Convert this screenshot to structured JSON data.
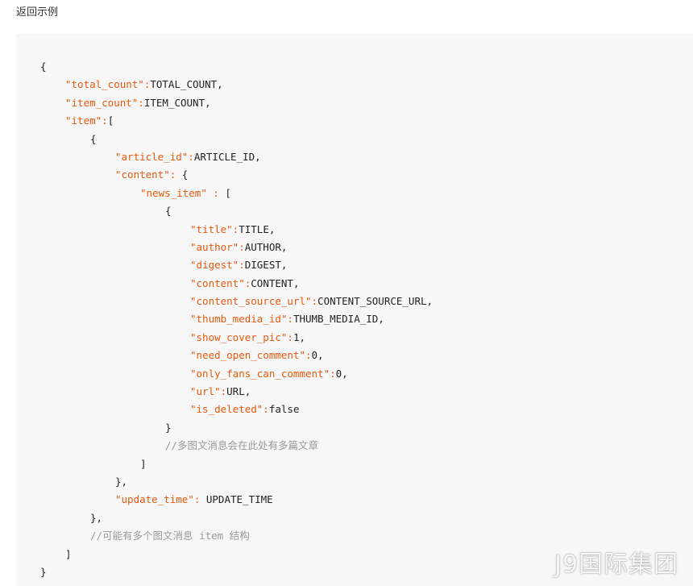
{
  "section_title": "返回示例",
  "watermark": "J9国际集团",
  "code_lines": [
    {
      "indent": 0,
      "segments": [
        {
          "t": "p",
          "v": "{"
        }
      ]
    },
    {
      "indent": 1,
      "segments": [
        {
          "t": "k",
          "v": "\"total_count\":"
        },
        {
          "t": "p",
          "v": "TOTAL_COUNT,"
        }
      ]
    },
    {
      "indent": 1,
      "segments": [
        {
          "t": "k",
          "v": "\"item_count\":"
        },
        {
          "t": "p",
          "v": "ITEM_COUNT,"
        }
      ]
    },
    {
      "indent": 1,
      "segments": [
        {
          "t": "k",
          "v": "\"item\":"
        },
        {
          "t": "p",
          "v": "["
        }
      ]
    },
    {
      "indent": 2,
      "segments": [
        {
          "t": "p",
          "v": "{"
        }
      ]
    },
    {
      "indent": 3,
      "segments": [
        {
          "t": "k",
          "v": "\"article_id\":"
        },
        {
          "t": "p",
          "v": "ARTICLE_ID,"
        }
      ]
    },
    {
      "indent": 3,
      "segments": [
        {
          "t": "k",
          "v": "\"content\":"
        },
        {
          "t": "p",
          "v": " {"
        }
      ]
    },
    {
      "indent": 4,
      "segments": [
        {
          "t": "k",
          "v": "\"news_item\" :"
        },
        {
          "t": "p",
          "v": " ["
        }
      ]
    },
    {
      "indent": 5,
      "segments": [
        {
          "t": "p",
          "v": "{"
        }
      ]
    },
    {
      "indent": 6,
      "segments": [
        {
          "t": "k",
          "v": "\"title\":"
        },
        {
          "t": "p",
          "v": "TITLE,"
        }
      ]
    },
    {
      "indent": 6,
      "segments": [
        {
          "t": "k",
          "v": "\"author\":"
        },
        {
          "t": "p",
          "v": "AUTHOR,"
        }
      ]
    },
    {
      "indent": 6,
      "segments": [
        {
          "t": "k",
          "v": "\"digest\":"
        },
        {
          "t": "p",
          "v": "DIGEST,"
        }
      ]
    },
    {
      "indent": 6,
      "segments": [
        {
          "t": "k",
          "v": "\"content\":"
        },
        {
          "t": "p",
          "v": "CONTENT,"
        }
      ]
    },
    {
      "indent": 6,
      "segments": [
        {
          "t": "k",
          "v": "\"content_source_url\":"
        },
        {
          "t": "p",
          "v": "CONTENT_SOURCE_URL,"
        }
      ]
    },
    {
      "indent": 6,
      "segments": [
        {
          "t": "k",
          "v": "\"thumb_media_id\":"
        },
        {
          "t": "p",
          "v": "THUMB_MEDIA_ID,"
        }
      ]
    },
    {
      "indent": 6,
      "segments": [
        {
          "t": "k",
          "v": "\"show_cover_pic\":"
        },
        {
          "t": "p",
          "v": "1,"
        }
      ]
    },
    {
      "indent": 6,
      "segments": [
        {
          "t": "k",
          "v": "\"need_open_comment\":"
        },
        {
          "t": "p",
          "v": "0,"
        }
      ]
    },
    {
      "indent": 6,
      "segments": [
        {
          "t": "k",
          "v": "\"only_fans_can_comment\":"
        },
        {
          "t": "p",
          "v": "0,"
        }
      ]
    },
    {
      "indent": 6,
      "segments": [
        {
          "t": "k",
          "v": "\"url\":"
        },
        {
          "t": "p",
          "v": "URL,"
        }
      ]
    },
    {
      "indent": 6,
      "segments": [
        {
          "t": "k",
          "v": "\"is_deleted\":"
        },
        {
          "t": "p",
          "v": "false"
        }
      ]
    },
    {
      "indent": 5,
      "segments": [
        {
          "t": "p",
          "v": "}"
        }
      ]
    },
    {
      "indent": 5,
      "segments": [
        {
          "t": "c",
          "v": "//多图文消息会在此处有多篇文章"
        }
      ]
    },
    {
      "indent": 4,
      "segments": [
        {
          "t": "p",
          "v": "]"
        }
      ]
    },
    {
      "indent": 3,
      "segments": [
        {
          "t": "p",
          "v": "},"
        }
      ]
    },
    {
      "indent": 3,
      "segments": [
        {
          "t": "k",
          "v": "\"update_time\":"
        },
        {
          "t": "p",
          "v": " UPDATE_TIME"
        }
      ]
    },
    {
      "indent": 2,
      "segments": [
        {
          "t": "p",
          "v": "},"
        }
      ]
    },
    {
      "indent": 2,
      "segments": [
        {
          "t": "c",
          "v": "//可能有多个图文消息 item 结构"
        }
      ]
    },
    {
      "indent": 1,
      "segments": [
        {
          "t": "p",
          "v": "]"
        }
      ]
    },
    {
      "indent": 0,
      "segments": [
        {
          "t": "p",
          "v": "}"
        }
      ]
    }
  ]
}
